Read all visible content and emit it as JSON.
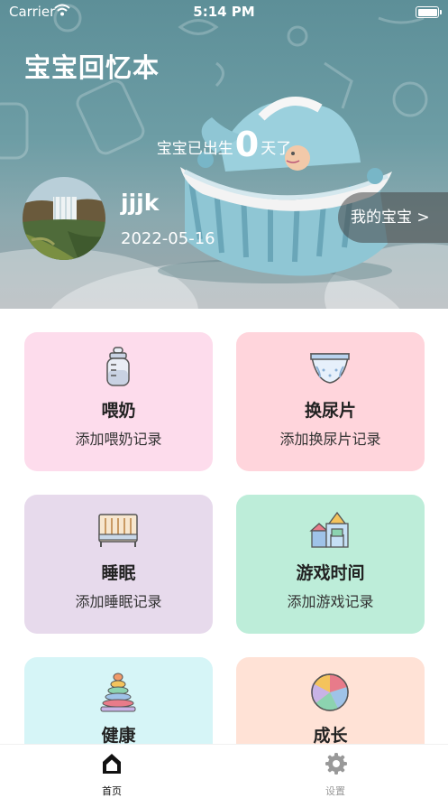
{
  "status_bar": {
    "carrier": "Carrier",
    "time": "5:14 PM"
  },
  "header": {
    "title": "宝宝回忆本",
    "days_prefix": "宝宝已出生",
    "days_value": "0",
    "days_suffix": "天了",
    "baby_name": "jjjk",
    "birth_date": "2022-05-16",
    "my_baby_label": "我的宝宝 >"
  },
  "cards": [
    {
      "title": "喂奶",
      "subtitle": "添加喂奶记录",
      "icon": "baby-bottle-icon",
      "color": "#fddcec"
    },
    {
      "title": "换尿片",
      "subtitle": "添加换尿片记录",
      "icon": "diaper-icon",
      "color": "#ffd5dc"
    },
    {
      "title": "睡眠",
      "subtitle": "添加睡眠记录",
      "icon": "crib-icon",
      "color": "#e7daec"
    },
    {
      "title": "游戏时间",
      "subtitle": "添加游戏记录",
      "icon": "toy-blocks-icon",
      "color": "#bdedd9"
    },
    {
      "title": "健康",
      "subtitle": "",
      "icon": "ring-stacker-icon",
      "color": "#d6f5f7"
    },
    {
      "title": "成长",
      "subtitle": "",
      "icon": "ball-icon",
      "color": "#ffe2d6"
    }
  ],
  "tabbar": {
    "home_label": "首页",
    "settings_label": "设置",
    "active_color": "#111111",
    "inactive_color": "#999999"
  }
}
